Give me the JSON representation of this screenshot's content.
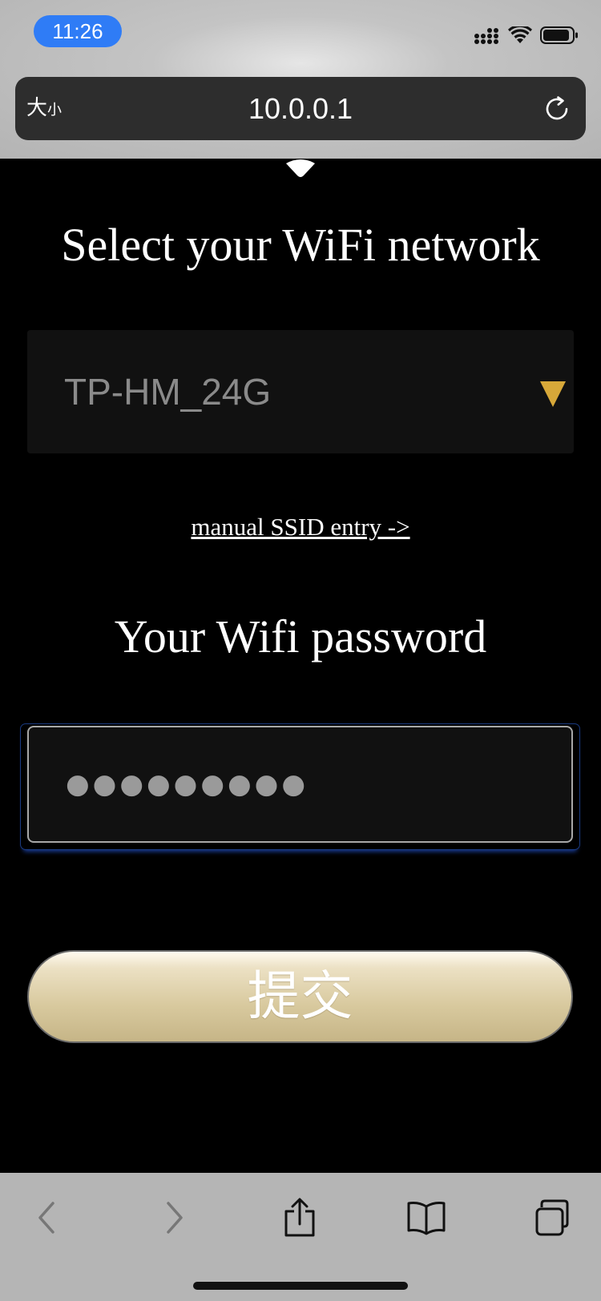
{
  "status_bar": {
    "time": "11:26",
    "icons": [
      "cellular-signal-icon",
      "wifi-icon",
      "battery-icon"
    ]
  },
  "browser": {
    "text_size_label_large": "大",
    "text_size_label_small": "小",
    "url": "10.0.0.1",
    "reload_icon": "reload-icon"
  },
  "page": {
    "network_heading": "Select your WiFi network",
    "network_selected": "TP-HM_24G",
    "manual_link": "manual SSID entry ->",
    "password_heading": "Your Wifi password",
    "password_value": "●●●●●●●●●",
    "submit_label": "提交",
    "accent_colors": {
      "arrow": "#d7a839",
      "button_gold": "#d8c99e",
      "status_pill": "#2f7cf6"
    }
  },
  "toolbar": {
    "items": [
      "back-icon",
      "forward-icon",
      "share-icon",
      "bookmarks-icon",
      "tabs-icon"
    ]
  }
}
